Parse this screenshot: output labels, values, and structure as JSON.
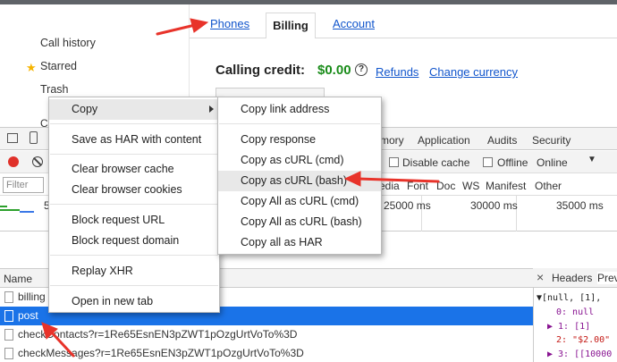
{
  "sidebar": {
    "items": [
      {
        "label": "Call history"
      },
      {
        "label": "Starred"
      },
      {
        "label": "Trash"
      }
    ],
    "partial_bullet": "C"
  },
  "tabs": {
    "phones": "Phones",
    "billing": "Billing",
    "account": "Account"
  },
  "billing": {
    "credit_label": "Calling credit:",
    "amount": "$0.00",
    "help_glyph": "?",
    "refunds_link": "Refunds",
    "change_currency_link": "Change currency"
  },
  "devtools": {
    "panel_tabs": [
      "mory",
      "Application",
      "Audits",
      "Security"
    ],
    "disable_cache": "Disable cache",
    "offline": "Offline",
    "throttle_value": "Online",
    "filter_placeholder": "Filter",
    "type_filters": [
      "edia",
      "Font",
      "Doc",
      "WS",
      "Manifest",
      "Other"
    ],
    "timeline_labels": [
      "25000 ms",
      "30000 ms",
      "35000 ms"
    ],
    "partial_timeline_digit": "5",
    "name_header": "Name",
    "requests": [
      "billing",
      "post",
      "checkContacts?r=1Re65EsnEN3pZWT1pOzgUrtVoTo%3D",
      "checkMessages?r=1Re65EsnEN3pZWT1pOzgUrtVoTo%3D"
    ],
    "right_tabs": {
      "headers": "Headers",
      "preview_partial": "Prev"
    },
    "close_glyph": "×",
    "preview_lines": [
      "▼[null, [1],",
      "0: null",
      "▶ 1: [1]",
      "2: \"$2.00\"",
      "▶ 3: [[10000"
    ]
  },
  "context_menu": {
    "items": [
      "Copy",
      "Save as HAR with content",
      "Clear browser cache",
      "Clear browser cookies",
      "Block request URL",
      "Block request domain",
      "Replay XHR",
      "Open in new tab"
    ]
  },
  "copy_submenu": {
    "items": [
      "Copy link address",
      "Copy response",
      "Copy as cURL (cmd)",
      "Copy as cURL (bash)",
      "Copy All as cURL (cmd)",
      "Copy All as cURL (bash)",
      "Copy all as HAR"
    ]
  },
  "colors": {
    "accent": "#1a73e8",
    "annotation": "#e8332a",
    "credit_green": "#1a8c1a",
    "link_blue": "#1155cc"
  }
}
